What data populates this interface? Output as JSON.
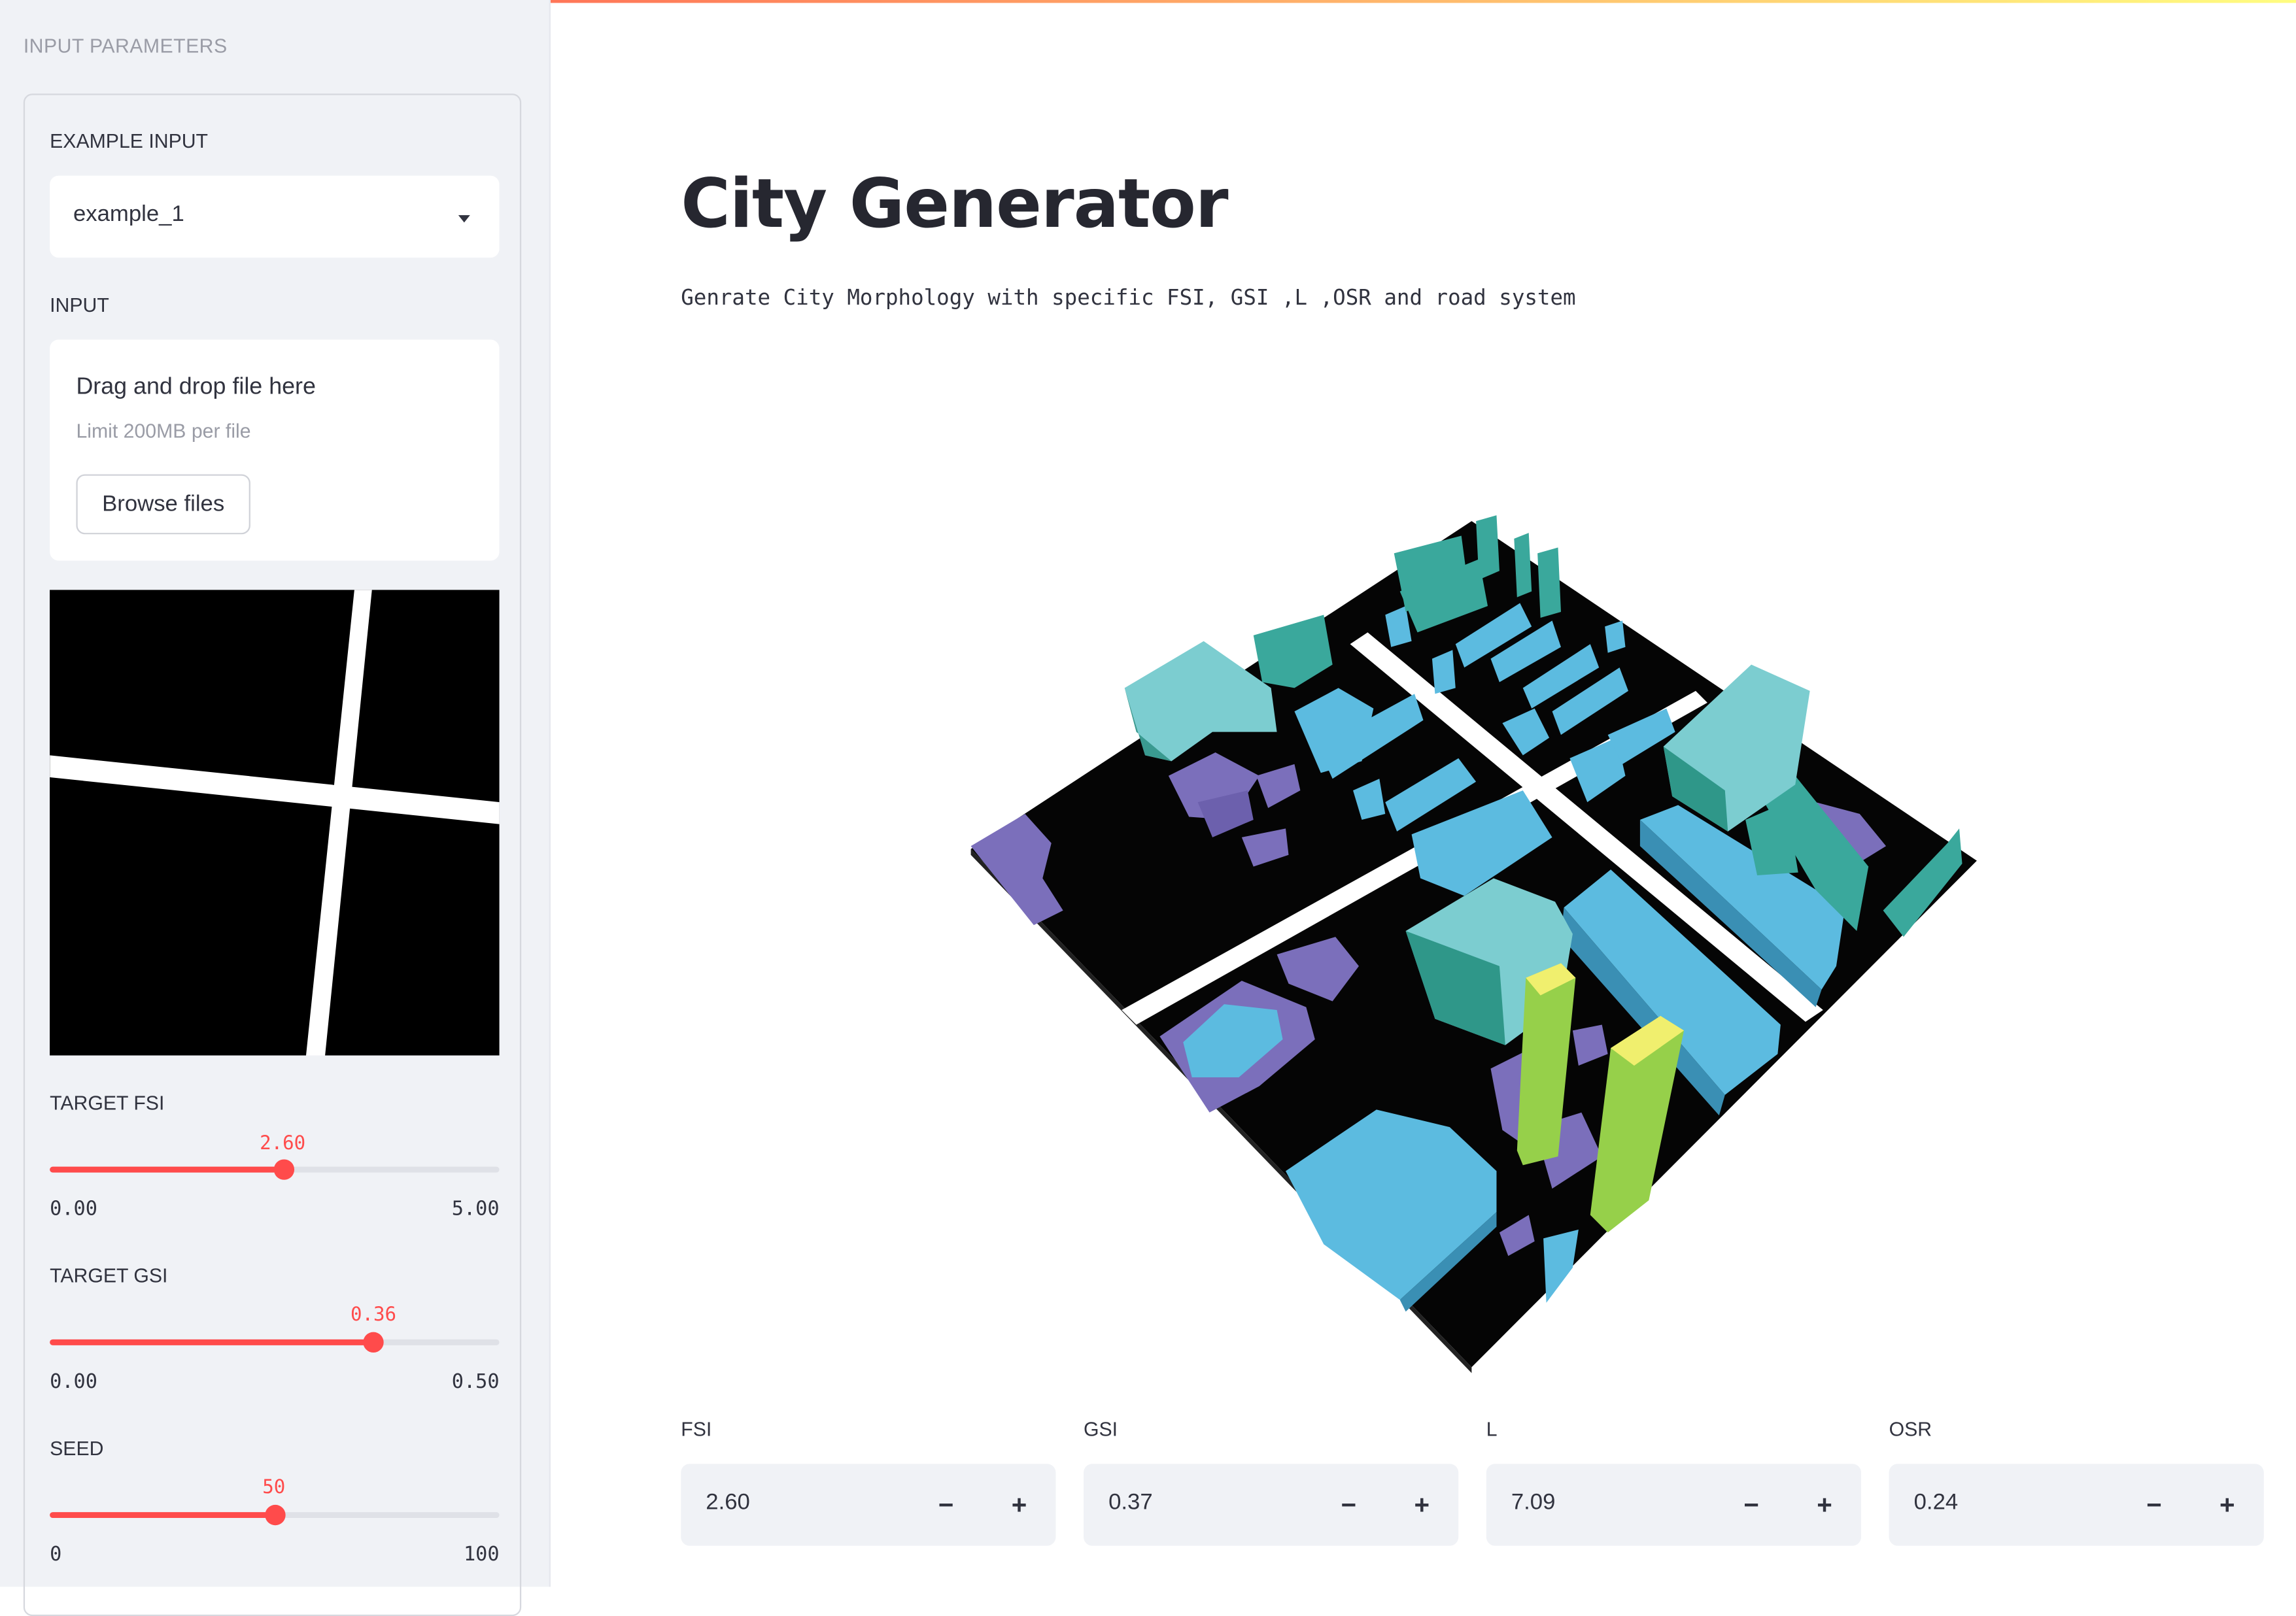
{
  "sidebar": {
    "title": "INPUT PARAMETERS",
    "example_input": {
      "label": "EXAMPLE INPUT",
      "value": "example_1"
    },
    "input": {
      "label": "INPUT",
      "drop_text": "Drag and drop file here",
      "limit_text": "Limit 200MB per file",
      "browse_label": "Browse files"
    },
    "sliders": [
      {
        "label": "TARGET FSI",
        "value": "2.60",
        "min": "0.00",
        "max": "5.00",
        "fraction": 0.52
      },
      {
        "label": "TARGET GSI",
        "value": "0.36",
        "min": "0.00",
        "max": "0.50",
        "fraction": 0.72
      },
      {
        "label": "SEED",
        "value": "50",
        "min": "0",
        "max": "100",
        "fraction": 0.5
      }
    ]
  },
  "main": {
    "title": "City Generator",
    "subtitle": "Genrate City Morphology with specific FSI, GSI ,L ,OSR and road system"
  },
  "metrics": [
    {
      "label": "FSI",
      "value": "2.60"
    },
    {
      "label": "GSI",
      "value": "0.37"
    },
    {
      "label": "L",
      "value": "7.09"
    },
    {
      "label": "OSR",
      "value": "0.24"
    }
  ],
  "controls": {
    "minus": "−",
    "plus": "+"
  },
  "colors": {
    "accent": "#ff4b4b",
    "purple": "#7b6fbb",
    "blue": "#5cbbe0",
    "teal": "#3aa89c",
    "green": "#96d04a",
    "yellow": "#f0ef6e"
  },
  "icons": {
    "select_caret": "chevron-down-icon"
  }
}
